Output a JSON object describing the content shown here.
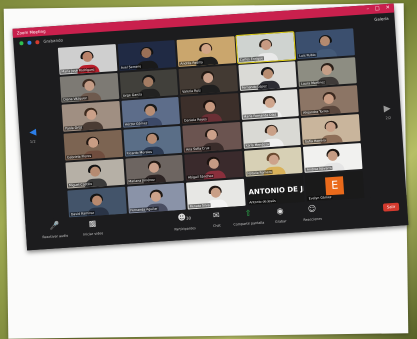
{
  "window": {
    "title": "Zoom Meeting",
    "controls": [
      "minimize-icon",
      "maximize-icon",
      "close-icon"
    ]
  },
  "meeting": {
    "recording_label": "Grabando",
    "view_label": "Galería"
  },
  "participants": [
    {
      "name": "María José Rodríguez",
      "bg": "#cfcfcf",
      "skin": "#b9826a",
      "hair": "#121212",
      "shirt": "#b91d2a"
    },
    {
      "name": "Axel Serrano",
      "bg": "#202a44",
      "skin": "#9a7057",
      "hair": "#121212",
      "shirt": "#1a1a1a"
    },
    {
      "name": "Andrés Padilla",
      "bg": "#caa66d",
      "skin": "#d2a587",
      "hair": "#2b1d14",
      "shirt": "#1d1d1d"
    },
    {
      "name": "Carlos Enrique",
      "bg": "#cfd3d0",
      "skin": "#c79a82",
      "hair": "#2e241c",
      "shirt": "#e9e9e9"
    },
    {
      "name": "Luis Rubio",
      "bg": "#3b4f6e",
      "skin": "#b48a70",
      "hair": "#121212",
      "shirt": "#445a78"
    },
    {
      "name": "Diana Vázquez",
      "bg": "#7d7a74",
      "skin": "#c49c86",
      "hair": "#3b2a20",
      "shirt": "#6e5a4e"
    },
    {
      "name": "Jorge García",
      "bg": "#41403b",
      "skin": "#a47c63",
      "hair": "#161616",
      "shirt": "#222222"
    },
    {
      "name": "Valeria Ruiz",
      "bg": "#433a33",
      "skin": "#caa08a",
      "hair": "#241a14",
      "shirt": "#1e1e1e"
    },
    {
      "name": "Fernando López",
      "bg": "#dadad6",
      "skin": "#b88d71",
      "hair": "#171717",
      "shirt": "#2d2d33"
    },
    {
      "name": "Laura Martínez",
      "bg": "#8d8d82",
      "skin": "#c59e86",
      "hair": "#2b1f18",
      "shirt": "#3e3a38"
    },
    {
      "name": "Paola Ortiz",
      "bg": "#a08f82",
      "skin": "#caa089",
      "hair": "#3c2a1e",
      "shirt": "#4a3c34"
    },
    {
      "name": "Héctor Gómez",
      "bg": "#5d6d8a",
      "skin": "#b98e74",
      "hair": "#1a1a1a",
      "shirt": "#3c4968"
    },
    {
      "name": "Daniela Reyes",
      "bg": "#3c2f2a",
      "skin": "#c79980",
      "hair": "#1e1410",
      "shirt": "#6b2f35"
    },
    {
      "name": "María Fernanda Díaz",
      "bg": "#e2e2df",
      "skin": "#cfa58c",
      "hair": "#2d2119",
      "shirt": "#f0f0f0"
    },
    {
      "name": "Alejandra Torres",
      "bg": "#8c7565",
      "skin": "#c89c83",
      "hair": "#3a281e",
      "shirt": "#5a463c"
    },
    {
      "name": "Gabriela Flores",
      "bg": "#7c6452",
      "skin": "#c99d84",
      "hair": "#1f1612",
      "shirt": "#704d3e"
    },
    {
      "name": "Ricardo Morales",
      "bg": "#5a6e87",
      "skin": "#b88c72",
      "hair": "#181818",
      "shirt": "#2c3a52"
    },
    {
      "name": "Ana Sofía Cruz",
      "bg": "#6b5450",
      "skin": "#cba08a",
      "hair": "#231914",
      "shirt": "#3a2c2a"
    },
    {
      "name": "Karla Mendoza",
      "bg": "#d9d9d4",
      "skin": "#c9a087",
      "hair": "#2f231b",
      "shirt": "#efefef"
    },
    {
      "name": "Sofía Herrera",
      "bg": "#c9b59c",
      "skin": "#caa189",
      "hair": "#2a1e17",
      "shirt": "#8e6e58"
    },
    {
      "name": "Miguel Castillo",
      "bg": "#b6b0a6",
      "skin": "#b68b71",
      "hair": "#141414",
      "shirt": "#3a3a3a"
    },
    {
      "name": "Mariana Jiménez",
      "bg": "#6d6561",
      "skin": "#caa08a",
      "hair": "#241913",
      "shirt": "#2d2424"
    },
    {
      "name": "Abigail Sánchez",
      "bg": "#3a2a2c",
      "skin": "#c59b84",
      "hair": "#1b1310",
      "shirt": "#8a2f3c"
    },
    {
      "name": "Natalia Romero",
      "bg": "#d7d0b5",
      "skin": "#cda38b",
      "hair": "#6a4a30",
      "shirt": "#d9b25a"
    },
    {
      "name": "Andrea Navarro",
      "bg": "#f1f1ef",
      "skin": "#c79c83",
      "hair": "#1c1511",
      "shirt": "#e5e5e5"
    },
    {
      "name": "David Ramírez",
      "bg": "#43546a",
      "skin": "#b8896e",
      "hair": "#151515",
      "shirt": "#2a3446"
    },
    {
      "name": "Fernanda Aguilar",
      "bg": "#8a93a8",
      "skin": "#cca28a",
      "hair": "#1e1814",
      "shirt": "#4a4e62"
    },
    {
      "name": "Renata Silva",
      "bg": "#e7e7e4",
      "skin": "#c99f86",
      "hair": "#241a15",
      "shirt": "#f2f2f2"
    }
  ],
  "text_tiles": [
    {
      "display": "ANTONIO DE JE...",
      "name": "Antonio de Jesús"
    },
    {
      "avatar_letter": "E",
      "name": "Evelyn Gómez"
    }
  ],
  "pages": {
    "left": "1/2",
    "right": "2/2"
  },
  "toolbar": {
    "items": [
      {
        "icon": "microphone-icon",
        "label": "Reactivar audio"
      },
      {
        "icon": "video-camera-icon",
        "label": "Iniciar video"
      },
      {
        "icon": "participants-icon",
        "label": "Participantes",
        "count": "30"
      },
      {
        "icon": "chat-icon",
        "label": "Chat"
      },
      {
        "icon": "share-screen-icon",
        "label": "Compartir pantalla"
      },
      {
        "icon": "record-icon",
        "label": "Grabar"
      },
      {
        "icon": "reactions-icon",
        "label": "Reacciones"
      }
    ],
    "end_label": "Salir"
  }
}
